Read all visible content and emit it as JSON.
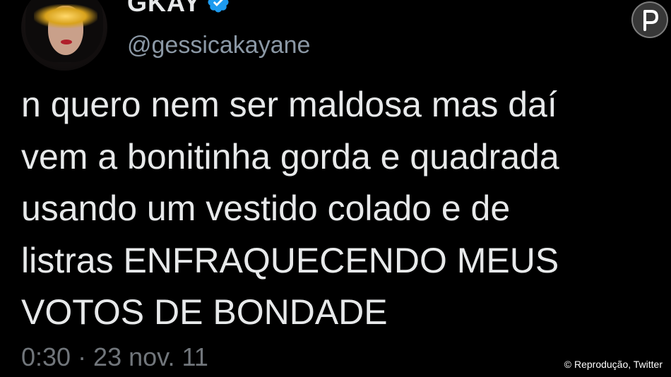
{
  "profile": {
    "display_name": "GKAY",
    "handle": "@gessicakayane",
    "verified": true,
    "verified_icon": "verified-badge-icon",
    "avatar_icon": "avatar-image"
  },
  "tweet": {
    "lines": [
      "n quero nem ser maldosa mas daí",
      "vem a bonitinha gorda e quadrada",
      "usando um vestido colado e de",
      "listras ENFRAQUECENDO MEUS",
      "VOTOS DE BONDADE"
    ],
    "timestamp": "0:30 · 23 nov. 11"
  },
  "overlay": {
    "credit": "© Reprodução, Twitter",
    "watermark_icon": "purepeople-logo-icon"
  },
  "colors": {
    "background": "#000000",
    "text": "#e7e9ea",
    "secondary": "#8b98a5",
    "verified": "#1d9bf0"
  }
}
